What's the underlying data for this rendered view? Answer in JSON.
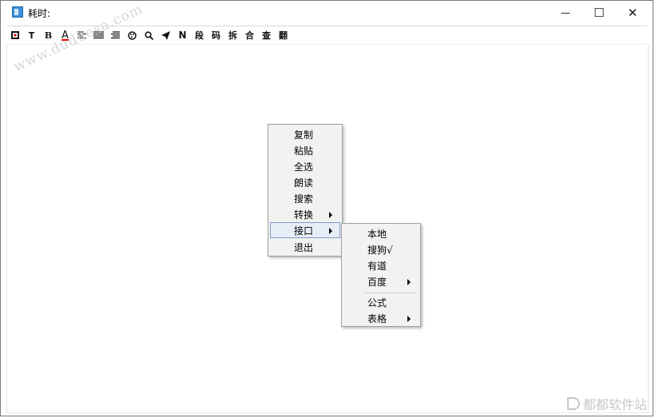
{
  "window": {
    "title": "耗时:",
    "minimize": "—",
    "maximize": "☐",
    "close": "✕"
  },
  "toolbar": {
    "items": [
      {
        "name": "frame-icon",
        "text": ""
      },
      {
        "name": "text-t-button",
        "text": "T"
      },
      {
        "name": "bold-button",
        "text": "B"
      },
      {
        "name": "font-color-button",
        "text": "A"
      },
      {
        "name": "align-left-icon",
        "text": ""
      },
      {
        "name": "align-center-icon",
        "text": ""
      },
      {
        "name": "align-justify-icon",
        "text": ""
      },
      {
        "name": "palette-icon",
        "text": ""
      },
      {
        "name": "search-icon",
        "text": ""
      },
      {
        "name": "send-icon",
        "text": ""
      },
      {
        "name": "n-button",
        "text": "N"
      },
      {
        "name": "paragraph-button",
        "text": "段"
      },
      {
        "name": "code-button",
        "text": "码"
      },
      {
        "name": "split-button",
        "text": "拆"
      },
      {
        "name": "merge-button",
        "text": "合"
      },
      {
        "name": "lookup-button",
        "text": "查"
      },
      {
        "name": "translate-button",
        "text": "翻"
      }
    ],
    "font_color": "#e00000"
  },
  "watermark": {
    "top": "www.duduesa.com",
    "bottom": "都都软件站"
  },
  "context_menu": {
    "items": [
      "复制",
      "粘贴",
      "全选",
      "朗读",
      "搜索",
      "转换",
      "接口",
      "退出"
    ],
    "submenu_flags": [
      false,
      false,
      false,
      false,
      false,
      true,
      true,
      false
    ],
    "highlighted_index": 6
  },
  "sub_menu": {
    "items": [
      "本地",
      "搜狗√",
      "有道",
      "百度",
      "公式",
      "表格"
    ],
    "submenu_flags": [
      false,
      false,
      false,
      true,
      false,
      true
    ]
  }
}
